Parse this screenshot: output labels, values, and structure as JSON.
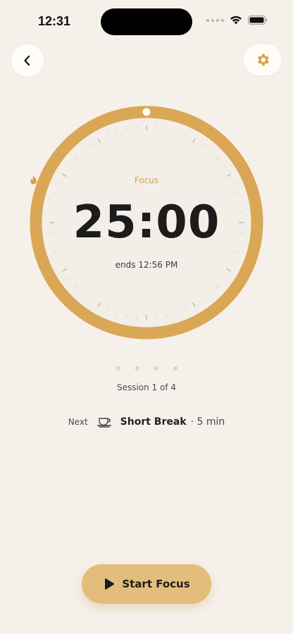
{
  "status_bar": {
    "time": "12:31",
    "icons": [
      "signal-dots-icon",
      "wifi-icon",
      "battery-icon"
    ]
  },
  "header": {
    "back_icon": "chevron-left-icon",
    "settings_icon": "gear-icon"
  },
  "timer": {
    "mode_icon": "flame-icon",
    "mode": "Focus",
    "time": "25:00",
    "ends": "ends 12:56 PM",
    "progress": 1.0
  },
  "sessions": {
    "current": 1,
    "total": 4,
    "label": "Session 1 of 4"
  },
  "next": {
    "label": "Next",
    "icon": "cup-icon",
    "name": "Short Break",
    "duration": "· 5 min"
  },
  "action": {
    "icon": "play-icon",
    "label": "Start Focus"
  },
  "colors": {
    "background": "#f5f1ea",
    "accent": "#d9a756",
    "button": "#e3bd7b",
    "text": "#1c1c1c"
  }
}
